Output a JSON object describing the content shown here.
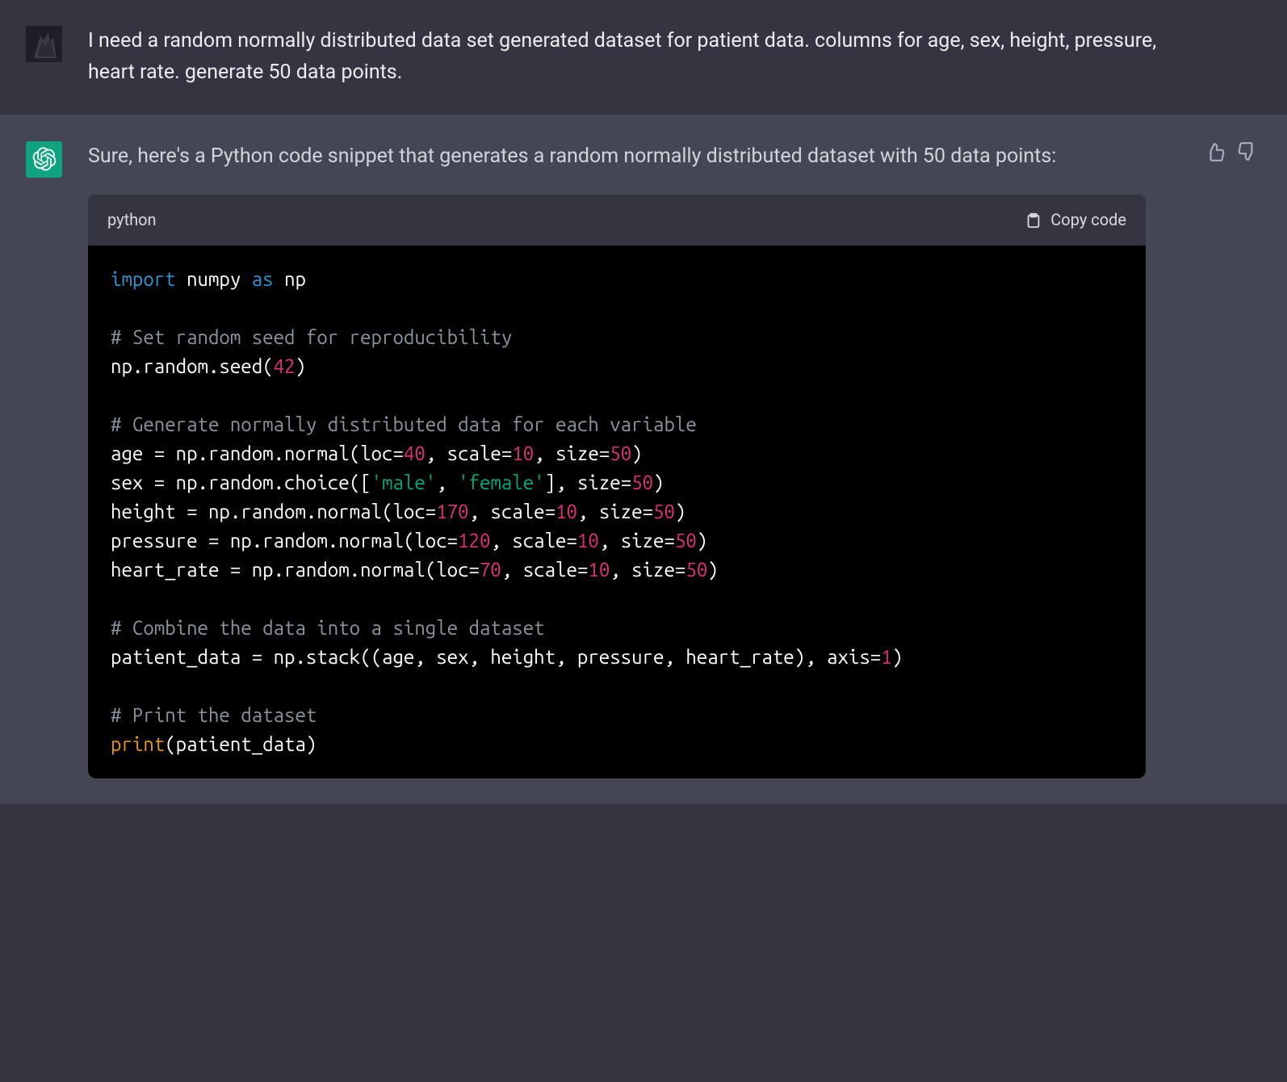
{
  "messages": {
    "user_text": "I need a random normally distributed data set generated dataset for patient data. columns for age, sex, height, pressure, heart rate. generate 50 data points.",
    "assistant_intro": "Sure, here's a Python code snippet that generates a random normally distributed dataset with 50 data points:"
  },
  "code_block": {
    "language_label": "python",
    "copy_label": "Copy code",
    "tokens": [
      {
        "t": "import",
        "c": "keyword"
      },
      {
        "t": " numpy ",
        "c": "default"
      },
      {
        "t": "as",
        "c": "keyword"
      },
      {
        "t": " np",
        "c": "default"
      },
      {
        "t": "\n",
        "c": "default"
      },
      {
        "t": "\n",
        "c": "default"
      },
      {
        "t": "# Set random seed for reproducibility",
        "c": "comment"
      },
      {
        "t": "\n",
        "c": "default"
      },
      {
        "t": "np.random.seed(",
        "c": "default"
      },
      {
        "t": "42",
        "c": "number"
      },
      {
        "t": ")",
        "c": "default"
      },
      {
        "t": "\n",
        "c": "default"
      },
      {
        "t": "\n",
        "c": "default"
      },
      {
        "t": "# Generate normally distributed data for each variable",
        "c": "comment"
      },
      {
        "t": "\n",
        "c": "default"
      },
      {
        "t": "age = np.random.normal(loc=",
        "c": "default"
      },
      {
        "t": "40",
        "c": "number"
      },
      {
        "t": ", scale=",
        "c": "default"
      },
      {
        "t": "10",
        "c": "number"
      },
      {
        "t": ", size=",
        "c": "default"
      },
      {
        "t": "50",
        "c": "number"
      },
      {
        "t": ")",
        "c": "default"
      },
      {
        "t": "\n",
        "c": "default"
      },
      {
        "t": "sex = np.random.choice([",
        "c": "default"
      },
      {
        "t": "'male'",
        "c": "string"
      },
      {
        "t": ", ",
        "c": "default"
      },
      {
        "t": "'female'",
        "c": "string"
      },
      {
        "t": "], size=",
        "c": "default"
      },
      {
        "t": "50",
        "c": "number"
      },
      {
        "t": ")",
        "c": "default"
      },
      {
        "t": "\n",
        "c": "default"
      },
      {
        "t": "height = np.random.normal(loc=",
        "c": "default"
      },
      {
        "t": "170",
        "c": "number"
      },
      {
        "t": ", scale=",
        "c": "default"
      },
      {
        "t": "10",
        "c": "number"
      },
      {
        "t": ", size=",
        "c": "default"
      },
      {
        "t": "50",
        "c": "number"
      },
      {
        "t": ")",
        "c": "default"
      },
      {
        "t": "\n",
        "c": "default"
      },
      {
        "t": "pressure = np.random.normal(loc=",
        "c": "default"
      },
      {
        "t": "120",
        "c": "number"
      },
      {
        "t": ", scale=",
        "c": "default"
      },
      {
        "t": "10",
        "c": "number"
      },
      {
        "t": ", size=",
        "c": "default"
      },
      {
        "t": "50",
        "c": "number"
      },
      {
        "t": ")",
        "c": "default"
      },
      {
        "t": "\n",
        "c": "default"
      },
      {
        "t": "heart_rate = np.random.normal(loc=",
        "c": "default"
      },
      {
        "t": "70",
        "c": "number"
      },
      {
        "t": ", scale=",
        "c": "default"
      },
      {
        "t": "10",
        "c": "number"
      },
      {
        "t": ", size=",
        "c": "default"
      },
      {
        "t": "50",
        "c": "number"
      },
      {
        "t": ")",
        "c": "default"
      },
      {
        "t": "\n",
        "c": "default"
      },
      {
        "t": "\n",
        "c": "default"
      },
      {
        "t": "# Combine the data into a single dataset",
        "c": "comment"
      },
      {
        "t": "\n",
        "c": "default"
      },
      {
        "t": "patient_data = np.stack((age, sex, height, pressure, heart_rate), axis=",
        "c": "default"
      },
      {
        "t": "1",
        "c": "number"
      },
      {
        "t": ")",
        "c": "default"
      },
      {
        "t": "\n",
        "c": "default"
      },
      {
        "t": "\n",
        "c": "default"
      },
      {
        "t": "# Print the dataset",
        "c": "comment"
      },
      {
        "t": "\n",
        "c": "default"
      },
      {
        "t": "print",
        "c": "builtin"
      },
      {
        "t": "(patient_data)",
        "c": "default"
      }
    ]
  }
}
